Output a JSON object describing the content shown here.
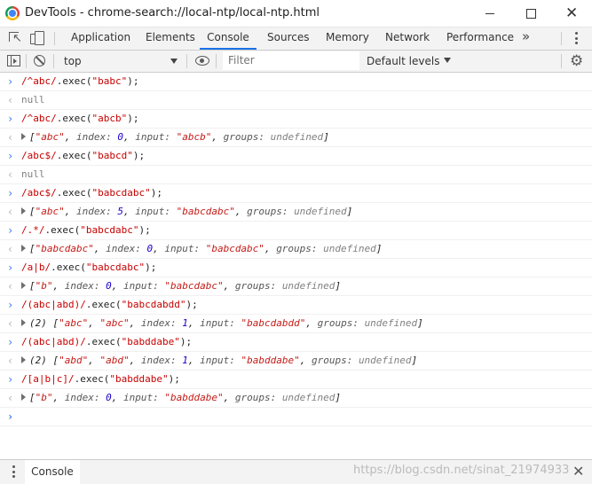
{
  "window": {
    "title": "DevTools - chrome-search://local-ntp/local-ntp.html",
    "minimize": "",
    "maximize": "",
    "close": "✕"
  },
  "tabs": [
    {
      "label": "Application"
    },
    {
      "label": "Elements"
    },
    {
      "label": "Console",
      "active": true
    },
    {
      "label": "Sources"
    },
    {
      "label": "Memory"
    },
    {
      "label": "Network"
    },
    {
      "label": "Performance"
    }
  ],
  "toolbar": {
    "more_tabs": "»",
    "context": "top",
    "filter_placeholder": "Filter",
    "filter_value": "",
    "levels": "Default levels",
    "settings": "⚙"
  },
  "console_rows": [
    {
      "kind": "input",
      "prefix": "›",
      "parts": [
        [
          "regex",
          "/^abc/"
        ],
        [
          "text",
          ".exec("
        ],
        [
          "regex",
          "\"babc\""
        ],
        [
          "text",
          ");"
        ]
      ]
    },
    {
      "kind": "output",
      "prefix": "‹",
      "parts": [
        [
          "null",
          "null"
        ]
      ]
    },
    {
      "kind": "input",
      "prefix": "›",
      "parts": [
        [
          "regex",
          "/^abc/"
        ],
        [
          "text",
          ".exec("
        ],
        [
          "regex",
          "\"abcb\""
        ],
        [
          "text",
          ");"
        ]
      ]
    },
    {
      "kind": "output",
      "prefix": "‹",
      "expandable": true,
      "parts": [
        [
          "punc",
          "["
        ],
        [
          "str",
          "\"abc\""
        ],
        [
          "punc",
          ", "
        ],
        [
          "key",
          "index: "
        ],
        [
          "num",
          "0"
        ],
        [
          "punc",
          ", "
        ],
        [
          "key",
          "input: "
        ],
        [
          "str",
          "\"abcb\""
        ],
        [
          "punc",
          ", "
        ],
        [
          "key",
          "groups: "
        ],
        [
          "undef",
          "undefined"
        ],
        [
          "punc",
          "]"
        ]
      ]
    },
    {
      "kind": "input",
      "prefix": "›",
      "parts": [
        [
          "regex",
          "/abc$/"
        ],
        [
          "text",
          ".exec("
        ],
        [
          "regex",
          "\"babcd\""
        ],
        [
          "text",
          ");"
        ]
      ]
    },
    {
      "kind": "output",
      "prefix": "‹",
      "parts": [
        [
          "null",
          "null"
        ]
      ]
    },
    {
      "kind": "input",
      "prefix": "›",
      "parts": [
        [
          "regex",
          "/abc$/"
        ],
        [
          "text",
          ".exec("
        ],
        [
          "regex",
          "\"babcdabc\""
        ],
        [
          "text",
          ");"
        ]
      ]
    },
    {
      "kind": "output",
      "prefix": "‹",
      "expandable": true,
      "parts": [
        [
          "punc",
          "["
        ],
        [
          "str",
          "\"abc\""
        ],
        [
          "punc",
          ", "
        ],
        [
          "key",
          "index: "
        ],
        [
          "num",
          "5"
        ],
        [
          "punc",
          ", "
        ],
        [
          "key",
          "input: "
        ],
        [
          "str",
          "\"babcdabc\""
        ],
        [
          "punc",
          ", "
        ],
        [
          "key",
          "groups: "
        ],
        [
          "undef",
          "undefined"
        ],
        [
          "punc",
          "]"
        ]
      ]
    },
    {
      "kind": "input",
      "prefix": "›",
      "parts": [
        [
          "regex",
          "/.*/"
        ],
        [
          "text",
          ".exec("
        ],
        [
          "regex",
          "\"babcdabc\""
        ],
        [
          "text",
          ");"
        ]
      ]
    },
    {
      "kind": "output",
      "prefix": "‹",
      "expandable": true,
      "parts": [
        [
          "punc",
          "["
        ],
        [
          "str",
          "\"babcdabc\""
        ],
        [
          "punc",
          ", "
        ],
        [
          "key",
          "index: "
        ],
        [
          "num",
          "0"
        ],
        [
          "punc",
          ", "
        ],
        [
          "key",
          "input: "
        ],
        [
          "str",
          "\"babcdabc\""
        ],
        [
          "punc",
          ", "
        ],
        [
          "key",
          "groups: "
        ],
        [
          "undef",
          "undefined"
        ],
        [
          "punc",
          "]"
        ]
      ]
    },
    {
      "kind": "input",
      "prefix": "›",
      "parts": [
        [
          "regex",
          "/a|b/"
        ],
        [
          "text",
          ".exec("
        ],
        [
          "regex",
          "\"babcdabc\""
        ],
        [
          "text",
          ");"
        ]
      ]
    },
    {
      "kind": "output",
      "prefix": "‹",
      "expandable": true,
      "parts": [
        [
          "punc",
          "["
        ],
        [
          "str",
          "\"b\""
        ],
        [
          "punc",
          ", "
        ],
        [
          "key",
          "index: "
        ],
        [
          "num",
          "0"
        ],
        [
          "punc",
          ", "
        ],
        [
          "key",
          "input: "
        ],
        [
          "str",
          "\"babcdabc\""
        ],
        [
          "punc",
          ", "
        ],
        [
          "key",
          "groups: "
        ],
        [
          "undef",
          "undefined"
        ],
        [
          "punc",
          "]"
        ]
      ]
    },
    {
      "kind": "input",
      "prefix": "›",
      "parts": [
        [
          "regex",
          "/(abc|abd)/"
        ],
        [
          "text",
          ".exec("
        ],
        [
          "regex",
          "\"babcdabdd\""
        ],
        [
          "text",
          ");"
        ]
      ]
    },
    {
      "kind": "output",
      "prefix": "‹",
      "expandable": true,
      "parts": [
        [
          "punc",
          "(2) ["
        ],
        [
          "str",
          "\"abc\""
        ],
        [
          "punc",
          ", "
        ],
        [
          "str",
          "\"abc\""
        ],
        [
          "punc",
          ", "
        ],
        [
          "key",
          "index: "
        ],
        [
          "num",
          "1"
        ],
        [
          "punc",
          ", "
        ],
        [
          "key",
          "input: "
        ],
        [
          "str",
          "\"babcdabdd\""
        ],
        [
          "punc",
          ", "
        ],
        [
          "key",
          "groups: "
        ],
        [
          "undef",
          "undefined"
        ],
        [
          "punc",
          "]"
        ]
      ]
    },
    {
      "kind": "input",
      "prefix": "›",
      "parts": [
        [
          "regex",
          "/(abc|abd)/"
        ],
        [
          "text",
          ".exec("
        ],
        [
          "regex",
          "\"babddabe\""
        ],
        [
          "text",
          ");"
        ]
      ]
    },
    {
      "kind": "output",
      "prefix": "‹",
      "expandable": true,
      "parts": [
        [
          "punc",
          "(2) ["
        ],
        [
          "str",
          "\"abd\""
        ],
        [
          "punc",
          ", "
        ],
        [
          "str",
          "\"abd\""
        ],
        [
          "punc",
          ", "
        ],
        [
          "key",
          "index: "
        ],
        [
          "num",
          "1"
        ],
        [
          "punc",
          ", "
        ],
        [
          "key",
          "input: "
        ],
        [
          "str",
          "\"babddabe\""
        ],
        [
          "punc",
          ", "
        ],
        [
          "key",
          "groups: "
        ],
        [
          "undef",
          "undefined"
        ],
        [
          "punc",
          "]"
        ]
      ]
    },
    {
      "kind": "input",
      "prefix": "›",
      "parts": [
        [
          "regex",
          "/[a|b|c]/"
        ],
        [
          "text",
          ".exec("
        ],
        [
          "regex",
          "\"babddabe\""
        ],
        [
          "text",
          ");"
        ]
      ]
    },
    {
      "kind": "output",
      "prefix": "‹",
      "expandable": true,
      "parts": [
        [
          "punc",
          "["
        ],
        [
          "str",
          "\"b\""
        ],
        [
          "punc",
          ", "
        ],
        [
          "key",
          "index: "
        ],
        [
          "num",
          "0"
        ],
        [
          "punc",
          ", "
        ],
        [
          "key",
          "input: "
        ],
        [
          "str",
          "\"babddabe\""
        ],
        [
          "punc",
          ", "
        ],
        [
          "key",
          "groups: "
        ],
        [
          "undef",
          "undefined"
        ],
        [
          "punc",
          "]"
        ]
      ]
    },
    {
      "kind": "prompt",
      "prefix": "›",
      "parts": []
    }
  ],
  "drawer": {
    "tab": "Console",
    "close": "✕",
    "watermark": "https://blog.csdn.net/sinat_21974933"
  }
}
